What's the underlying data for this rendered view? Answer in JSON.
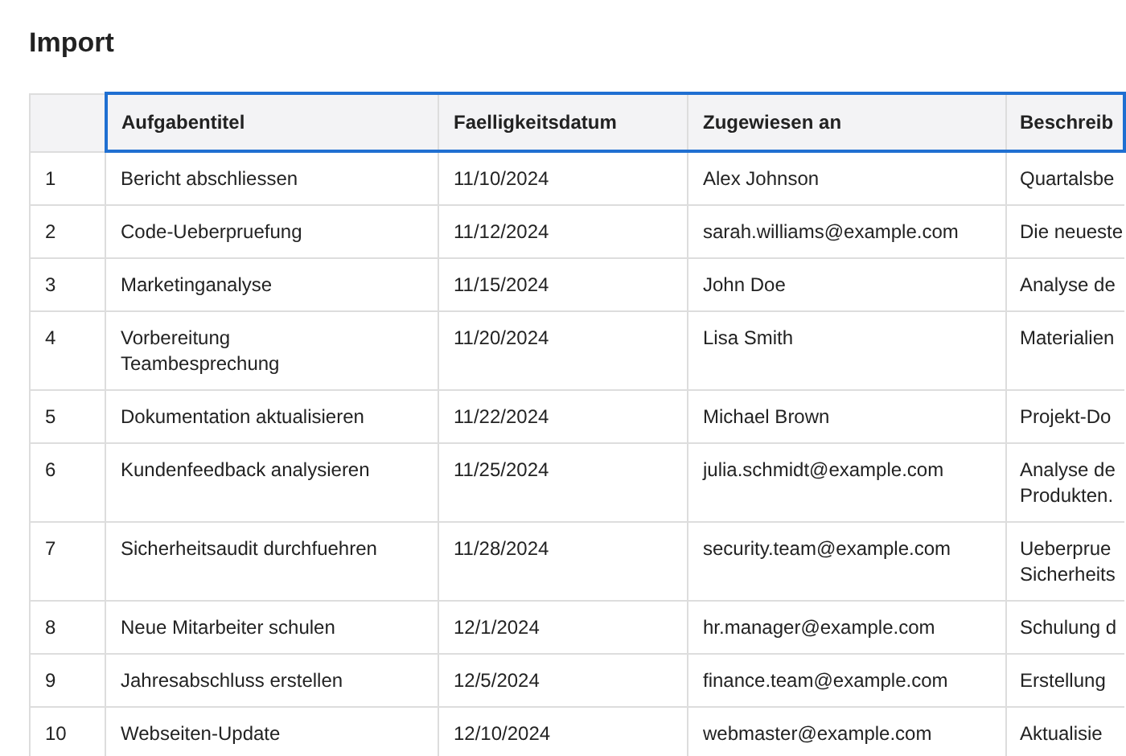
{
  "title": "Import",
  "table": {
    "header_selected": true,
    "columns": [
      "Aufgabentitel",
      "Faelligkeitsdatum",
      "Zugewiesen an",
      "Beschreib"
    ],
    "rows": [
      {
        "number": "1",
        "cells": [
          "Bericht abschliessen",
          "11/10/2024",
          "Alex Johnson",
          "Quartalsbe"
        ]
      },
      {
        "number": "2",
        "cells": [
          "Code-Ueberpruefung",
          "11/12/2024",
          "sarah.williams@example.com",
          "Die neueste"
        ]
      },
      {
        "number": "3",
        "cells": [
          "Marketinganalyse",
          "11/15/2024",
          "John Doe",
          "Analyse de"
        ]
      },
      {
        "number": "4",
        "cells": [
          "Vorbereitung\nTeambesprechung",
          "11/20/2024",
          "Lisa Smith",
          "Materialien"
        ]
      },
      {
        "number": "5",
        "cells": [
          "Dokumentation aktualisieren",
          "11/22/2024",
          "Michael Brown",
          "Projekt-Do"
        ]
      },
      {
        "number": "6",
        "cells": [
          "Kundenfeedback analysieren",
          "11/25/2024",
          "julia.schmidt@example.com",
          "Analyse de\nProdukten."
        ]
      },
      {
        "number": "7",
        "cells": [
          "Sicherheitsaudit durchfuehren",
          "11/28/2024",
          "security.team@example.com",
          "Ueberprue\nSicherheits"
        ]
      },
      {
        "number": "8",
        "cells": [
          "Neue Mitarbeiter schulen",
          "12/1/2024",
          "hr.manager@example.com",
          "Schulung d"
        ]
      },
      {
        "number": "9",
        "cells": [
          "Jahresabschluss erstellen",
          "12/5/2024",
          "finance.team@example.com",
          "Erstellung"
        ]
      },
      {
        "number": "10",
        "cells": [
          "Webseiten-Update",
          "12/10/2024",
          "webmaster@example.com",
          "Aktualisie"
        ]
      }
    ]
  }
}
